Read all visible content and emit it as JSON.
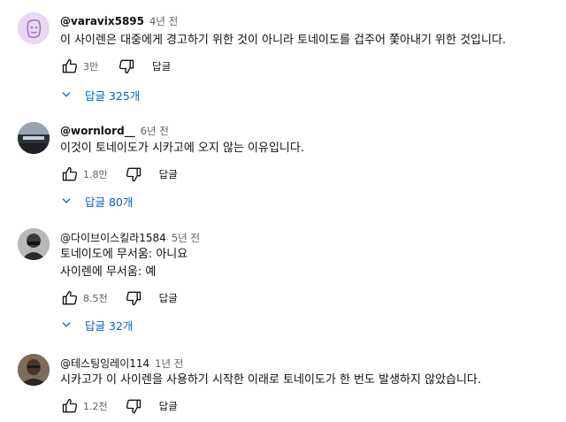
{
  "comments": [
    {
      "author": "@varavix5895",
      "time": "4년 전",
      "lines": [
        "이 사이렌은 대중에게 경고하기 위한 것이 아니라 토네이도를 겁주어 쫓아내기 위한 것입니다."
      ],
      "likes": "3만",
      "reply_label": "답글",
      "replies_label": "답글 325개",
      "avatar_color": "#e9d3f5"
    },
    {
      "author": "@wornlord__",
      "time": "6년 전",
      "lines": [
        "이것이 토네이도가 시카고에 오지 않는 이유입니다."
      ],
      "likes": "1.8만",
      "reply_label": "답글",
      "replies_label": "답글 80개",
      "avatar_color": "#3a3f47"
    },
    {
      "author": "@다이브이스킬라1584",
      "time": "5년 전",
      "lines": [
        "토네이도에 무서움: 아니요",
        "사이렌에 무서움: 예"
      ],
      "likes": "8.5천",
      "reply_label": "답글",
      "replies_label": "답글 32개",
      "avatar_color": "#8a8a8a"
    },
    {
      "author": "@테스팅잉레이114",
      "time": "1년 전",
      "lines": [
        "시카고가 이 사이렌을 사용하기 시작한 이래로 토네이도가 한 번도 발생하지 않았습니다."
      ],
      "likes": "1.2천",
      "reply_label": "답글",
      "avatar_color": "#5a4a3e"
    }
  ],
  "colors": {
    "link": "#065fd4",
    "muted": "#606060",
    "text": "#0f0f0f"
  }
}
